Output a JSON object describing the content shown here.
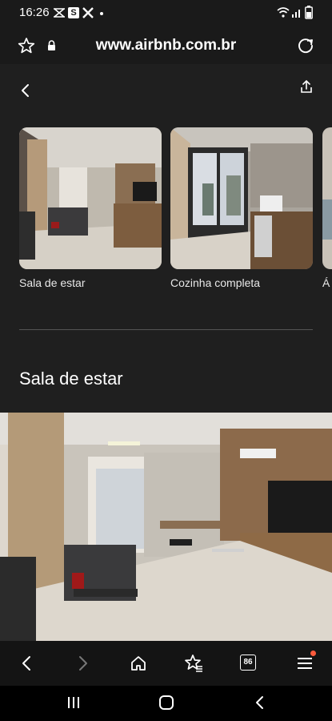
{
  "status_bar": {
    "time": "16:26",
    "icons": [
      "zoom-icon",
      "s-app-icon",
      "x-icon",
      "dot-icon",
      "wifi-icon",
      "signal-icon",
      "battery-icon"
    ]
  },
  "browser": {
    "url": "www.airbnb.com.br",
    "tab_count": "86"
  },
  "gallery": {
    "items": [
      {
        "caption": "Sala de estar"
      },
      {
        "caption": "Cozinha completa"
      },
      {
        "caption": "Á"
      }
    ]
  },
  "section": {
    "title": "Sala de estar"
  },
  "colors": {
    "background": "#1f1f1f",
    "notification_dot": "#ff5a3c"
  }
}
